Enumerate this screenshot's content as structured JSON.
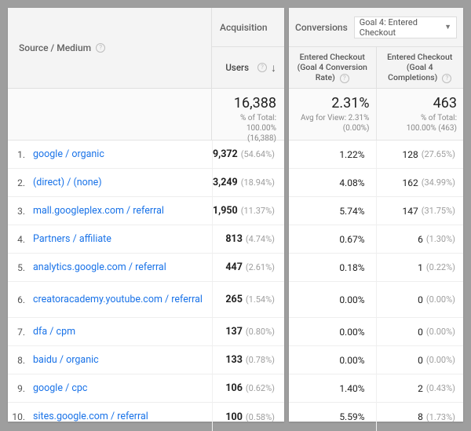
{
  "headers": {
    "dimension": "Source / Medium",
    "acquisition": "Acquisition",
    "users": "Users",
    "conversions": "Conversions",
    "goal_selected": "Goal 4: Entered Checkout",
    "rate_col": "Entered Checkout (Goal 4 Conversion Rate)",
    "comp_col": "Entered Checkout (Goal 4 Completions)"
  },
  "summary": {
    "users_total": "16,388",
    "users_sub1": "% of Total:",
    "users_sub2": "100.00%",
    "users_sub3": "(16,388)",
    "rate_total": "2.31%",
    "rate_sub1": "Avg for View: 2.31%",
    "rate_sub2": "(0.00%)",
    "comp_total": "463",
    "comp_sub1": "% of Total:",
    "comp_sub2": "100.00% (463)"
  },
  "rows": [
    {
      "idx": "1.",
      "src": "google / organic",
      "users": "9,372",
      "users_pct": "(54.64%)",
      "rate": "1.22%",
      "comp": "128",
      "comp_pct": "(27.65%)"
    },
    {
      "idx": "2.",
      "src": "(direct) / (none)",
      "users": "3,249",
      "users_pct": "(18.94%)",
      "rate": "4.08%",
      "comp": "162",
      "comp_pct": "(34.99%)"
    },
    {
      "idx": "3.",
      "src": "mall.googleplex.com / referral",
      "users": "1,950",
      "users_pct": "(11.37%)",
      "rate": "5.74%",
      "comp": "147",
      "comp_pct": "(31.75%)"
    },
    {
      "idx": "4.",
      "src": "Partners / affiliate",
      "users": "813",
      "users_pct": "(4.74%)",
      "rate": "0.67%",
      "comp": "6",
      "comp_pct": "(1.30%)"
    },
    {
      "idx": "5.",
      "src": "analytics.google.com / referral",
      "users": "447",
      "users_pct": "(2.61%)",
      "rate": "0.18%",
      "comp": "1",
      "comp_pct": "(0.22%)"
    },
    {
      "idx": "6.",
      "src": "creatoracademy.youtube.com / referral",
      "users": "265",
      "users_pct": "(1.54%)",
      "rate": "0.00%",
      "comp": "0",
      "comp_pct": "(0.00%)",
      "tall": true
    },
    {
      "idx": "7.",
      "src": "dfa / cpm",
      "users": "137",
      "users_pct": "(0.80%)",
      "rate": "0.00%",
      "comp": "0",
      "comp_pct": "(0.00%)"
    },
    {
      "idx": "8.",
      "src": "baidu / organic",
      "users": "133",
      "users_pct": "(0.78%)",
      "rate": "0.00%",
      "comp": "0",
      "comp_pct": "(0.00%)"
    },
    {
      "idx": "9.",
      "src": "google / cpc",
      "users": "106",
      "users_pct": "(0.62%)",
      "rate": "1.40%",
      "comp": "2",
      "comp_pct": "(0.43%)"
    },
    {
      "idx": "10.",
      "src": "sites.google.com / referral",
      "users": "100",
      "users_pct": "(0.58%)",
      "rate": "5.59%",
      "comp": "8",
      "comp_pct": "(1.73%)"
    }
  ]
}
